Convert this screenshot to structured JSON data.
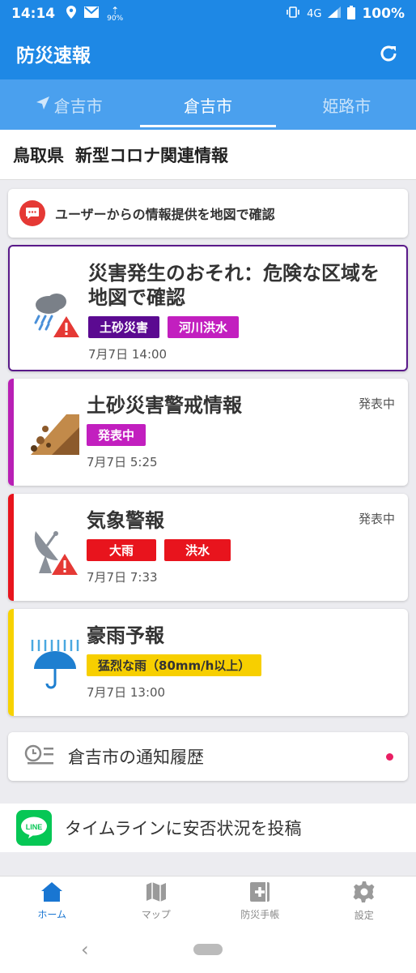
{
  "status_bar": {
    "time": "14:14",
    "network": "4G",
    "battery": "100%",
    "download_pct": "90%"
  },
  "app_bar": {
    "title": "防災速報"
  },
  "tabs": [
    {
      "label": "倉吉市",
      "active": false,
      "location": true
    },
    {
      "label": "倉吉市",
      "active": true
    },
    {
      "label": "姫路市",
      "active": false
    }
  ],
  "corona": {
    "prefecture": "鳥取県",
    "title": "新型コロナ関連情報"
  },
  "report": {
    "label": "ユーザーからの情報提供を地図で確認"
  },
  "alerts": [
    {
      "title": "災害発生のおそれ：危険な区域を地図で確認",
      "tags": [
        {
          "label": "土砂災害",
          "color": "#5b0a91"
        },
        {
          "label": "河川洪水",
          "color": "#c21fbf"
        }
      ],
      "time": "7月7日 14:00",
      "icon": "rain-warning-icon"
    },
    {
      "title": "土砂災害警戒情報",
      "state": "発表中",
      "tags": [
        {
          "label": "発表中",
          "color": "#c21fbf"
        }
      ],
      "time": "7月7日 5:25",
      "icon": "landslide-icon",
      "stripe": "#b81fb5"
    },
    {
      "title": "気象警報",
      "state": "発表中",
      "tags": [
        {
          "label": "大雨",
          "color": "#e8141d"
        },
        {
          "label": "洪水",
          "color": "#e8141d"
        }
      ],
      "time": "7月7日 7:33",
      "icon": "radar-warning-icon",
      "stripe": "#e8141d"
    },
    {
      "title": "豪雨予報",
      "tags": [
        {
          "label": "猛烈な雨（80mm/h以上）",
          "color": "#f7cf00",
          "text_color": "#333"
        }
      ],
      "time": "7月7日 13:00",
      "icon": "umbrella-rain-icon",
      "stripe": "#f7d200"
    }
  ],
  "history": {
    "label": "倉吉市の通知履歴"
  },
  "line_post": {
    "label": "タイムラインに安否状況を投稿",
    "logo_text": "LINE"
  },
  "bottom_nav": [
    {
      "label": "ホーム",
      "active": true
    },
    {
      "label": "マップ",
      "active": false
    },
    {
      "label": "防災手帳",
      "active": false
    },
    {
      "label": "設定",
      "active": false
    }
  ],
  "colors": {
    "primary": "#1e88e5",
    "tab_bg": "#4aa0ee",
    "line_green": "#06c755"
  }
}
